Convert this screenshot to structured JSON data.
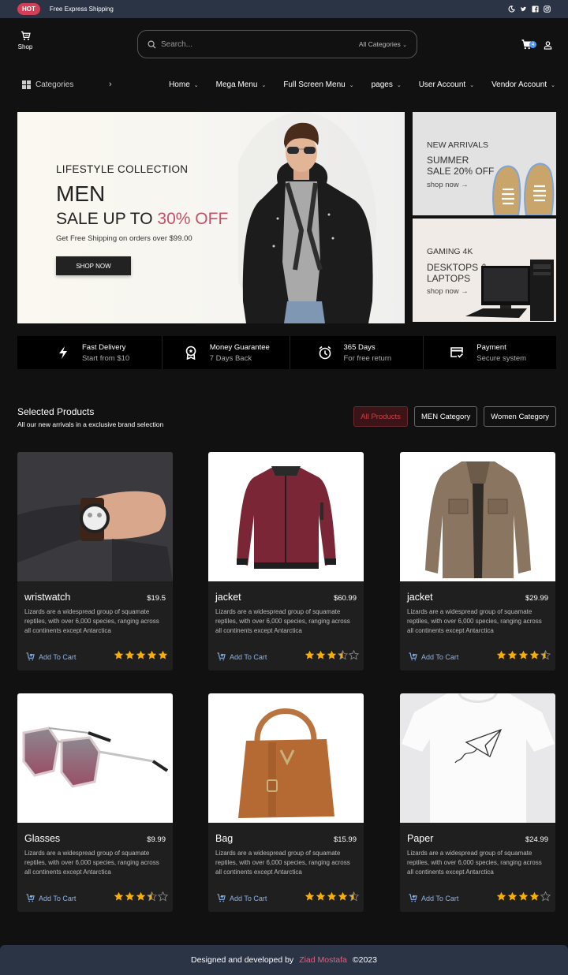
{
  "topbar": {
    "badge": "HOT",
    "text": "Free Express Shipping",
    "icons": [
      "moon-icon",
      "twitter-icon",
      "facebook-icon",
      "instagram-icon"
    ]
  },
  "header": {
    "shop_label": "Shop",
    "search_placeholder": "Search...",
    "category_select": "All Categories",
    "cart_count": "4"
  },
  "nav": {
    "categories_label": "Categories",
    "menu": [
      {
        "label": "Home"
      },
      {
        "label": "Mega Menu"
      },
      {
        "label": "Full Screen Menu"
      },
      {
        "label": "pages"
      },
      {
        "label": "User Account"
      },
      {
        "label": "Vendor Account"
      }
    ]
  },
  "hero": {
    "eyebrow": "LIFESTYLE COLLECTION",
    "title": "MEN",
    "sale_prefix": "SALE UP TO",
    "sale_highlight": "30% OFF",
    "subtitle": "Get Free Shipping on orders over $99.00",
    "cta": "SHOP NOW",
    "accent_color": "#c5506a"
  },
  "side_banners": [
    {
      "eyebrow": "NEW ARRIVALS",
      "line1": "SUMMER",
      "line2": "SALE 20% OFF",
      "link": "shop now →"
    },
    {
      "eyebrow": "GAMING 4K",
      "line1": "DESKTOPS &",
      "line2": "LAPTOPS",
      "link": "shop now →"
    }
  ],
  "features": [
    {
      "icon": "lightning-icon",
      "title": "Fast Delivery",
      "subtitle": "Start from $10"
    },
    {
      "icon": "award-icon",
      "title": "Money Guarantee",
      "subtitle": "7 Days Back"
    },
    {
      "icon": "alarm-clock-icon",
      "title": "365 Days",
      "subtitle": "For free return"
    },
    {
      "icon": "credit-card-check-icon",
      "title": "Payment",
      "subtitle": "Secure system"
    }
  ],
  "products_section": {
    "title": "Selected Products",
    "subtitle": "All our new arrivals in a exclusive brand selection",
    "filters": [
      {
        "label": "All Products",
        "active": true
      },
      {
        "label": "MEN Category",
        "active": false
      },
      {
        "label": "Women Category",
        "active": false
      }
    ]
  },
  "products": [
    {
      "name": "wristwatch",
      "price": "$19.5",
      "rating": 5,
      "image": "wristwatch-photo"
    },
    {
      "name": "jacket",
      "price": "$60.99",
      "rating": 3.5,
      "image": "burgundy-bomber-jacket-photo"
    },
    {
      "name": "jacket",
      "price": "$29.99",
      "rating": 4.5,
      "image": "khaki-field-jacket-photo"
    },
    {
      "name": "Glasses",
      "price": "$9.99",
      "rating": 3.5,
      "image": "sunglasses-photo"
    },
    {
      "name": "Bag",
      "price": "$15.99",
      "rating": 4.5,
      "image": "brown-handbag-photo"
    },
    {
      "name": "Paper",
      "price": "$24.99",
      "rating": 4,
      "image": "paper-plane-tshirt-photo"
    }
  ],
  "product_description": "Lizards are a widespread group of squamate reptiles, with over 6,000 species, ranging across all continents except Antarctica",
  "add_to_cart_label": "Add To Cart",
  "colors": {
    "star": "#faaf00",
    "star_empty": "#888888",
    "link": "#8ab4e8",
    "hot": "#d23f57",
    "badge": "#4e97fd"
  },
  "footer": {
    "prefix": "Designed and developed by",
    "author": "Ziad Mostafa",
    "suffix": "©2023"
  }
}
